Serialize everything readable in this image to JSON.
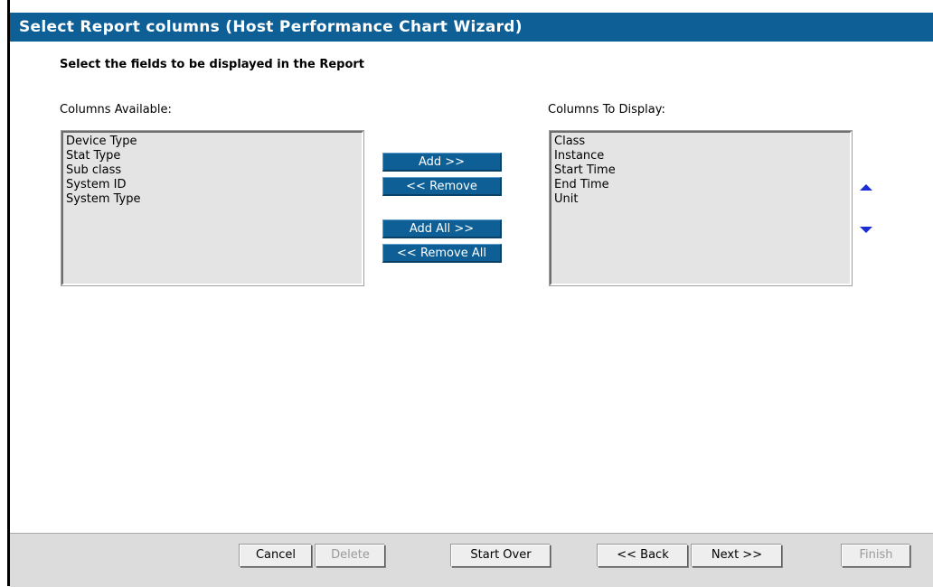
{
  "window": {
    "title": "Select Report columns (Host Performance Chart Wizard)"
  },
  "main": {
    "subtitle": "Select the fields to be displayed in the Report",
    "available_label": "Columns Available:",
    "display_label": "Columns To Display:",
    "available_items": [
      "Device Type",
      "Stat Type",
      "Sub class",
      "System ID",
      "System Type"
    ],
    "display_items": [
      "Class",
      "Instance",
      "Start Time",
      "End Time",
      "Unit"
    ],
    "buttons": {
      "add": "Add  >>",
      "remove": "<< Remove",
      "add_all": "Add All  >>",
      "remove_all": "<< Remove All"
    },
    "order_icons": {
      "up": "move-up-icon",
      "down": "move-down-icon"
    }
  },
  "footer": {
    "cancel": "Cancel",
    "delete": "Delete",
    "start_over": "Start Over",
    "back": "<< Back",
    "next": "Next >>",
    "finish": "Finish"
  },
  "colors": {
    "title_bar": "#0e5f96",
    "button_blue": "#0e5f96",
    "list_bg": "#e4e4e4",
    "arrow": "#1d2dd6",
    "footer_bg": "#dcdcdc"
  }
}
